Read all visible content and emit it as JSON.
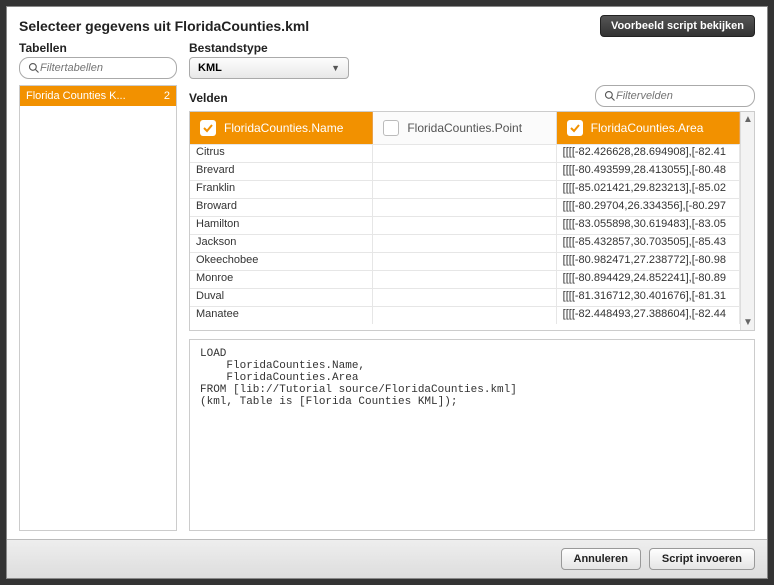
{
  "header": {
    "title": "Selecteer gegevens uit FloridaCounties.kml",
    "preview_btn": "Voorbeeld script bekijken"
  },
  "labels": {
    "tables": "Tabellen",
    "filetype": "Bestandstype",
    "fields": "Velden"
  },
  "inputs": {
    "filter_tables_placeholder": "Filtertabellen",
    "filter_fields_placeholder": "Filtervelden"
  },
  "filetype": {
    "value": "KML"
  },
  "tables": [
    {
      "name": "Florida Counties K...",
      "count": "2"
    }
  ],
  "fields": {
    "columns": [
      {
        "name": "FloridaCounties.Name",
        "selected": true
      },
      {
        "name": "FloridaCounties.Point",
        "selected": false
      },
      {
        "name": "FloridaCounties.Area",
        "selected": true
      }
    ],
    "rows": [
      {
        "c0": "Citrus",
        "c1": "",
        "c2": "[[[[-82.426628,28.694908],[-82.41"
      },
      {
        "c0": "Brevard",
        "c1": "",
        "c2": "[[[[-80.493599,28.413055],[-80.48"
      },
      {
        "c0": "Franklin",
        "c1": "",
        "c2": "[[[[-85.021421,29.823213],[-85.02"
      },
      {
        "c0": "Broward",
        "c1": "",
        "c2": "[[[[-80.29704,26.334356],[-80.297"
      },
      {
        "c0": "Hamilton",
        "c1": "",
        "c2": "[[[[-83.055898,30.619483],[-83.05"
      },
      {
        "c0": "Jackson",
        "c1": "",
        "c2": "[[[[-85.432857,30.703505],[-85.43"
      },
      {
        "c0": "Okeechobee",
        "c1": "",
        "c2": "[[[[-80.982471,27.238772],[-80.98"
      },
      {
        "c0": "Monroe",
        "c1": "",
        "c2": "[[[[-80.894429,24.852241],[-80.89"
      },
      {
        "c0": "Duval",
        "c1": "",
        "c2": "[[[[-81.316712,30.401676],[-81.31"
      },
      {
        "c0": "Manatee",
        "c1": "",
        "c2": "[[[[-82.448493,27.388604],[-82.44"
      }
    ]
  },
  "script": "LOAD\n    FloridaCounties.Name,\n    FloridaCounties.Area\nFROM [lib://Tutorial source/FloridaCounties.kml]\n(kml, Table is [Florida Counties KML]);",
  "footer": {
    "cancel": "Annuleren",
    "insert": "Script invoeren"
  }
}
